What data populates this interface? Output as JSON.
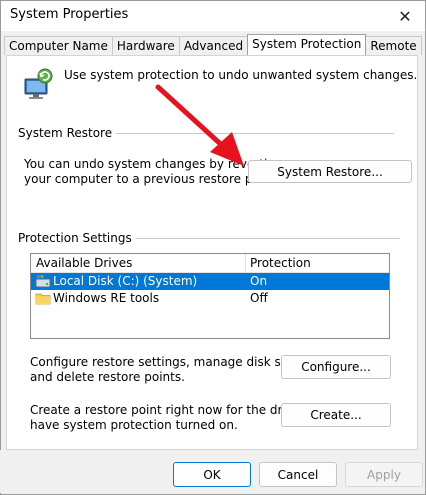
{
  "window": {
    "title": "System Properties"
  },
  "tabs": [
    {
      "label": "Computer Name"
    },
    {
      "label": "Hardware"
    },
    {
      "label": "Advanced"
    },
    {
      "label": "System Protection"
    },
    {
      "label": "Remote"
    }
  ],
  "active_tab": "System Protection",
  "intro": {
    "text": "Use system protection to undo unwanted system changes."
  },
  "system_restore": {
    "group_label": "System Restore",
    "description_line1": "You can undo system changes by reverting",
    "description_line2": "your computer to a previous restore point.",
    "button_label": "System Restore..."
  },
  "protection_settings": {
    "group_label": "Protection Settings",
    "columns": [
      "Available Drives",
      "Protection"
    ],
    "drives": [
      {
        "name": "Local Disk (C:) (System)",
        "protection": "On",
        "icon": "drive-icon",
        "selected": true
      },
      {
        "name": "Windows RE tools",
        "protection": "Off",
        "icon": "folder-icon",
        "selected": false
      }
    ],
    "configure_line1": "Configure restore settings, manage disk space,",
    "configure_line2": "and delete restore points.",
    "configure_button": "Configure...",
    "create_line1": "Create a restore point right now for the drives that",
    "create_line2": "have system protection turned on.",
    "create_button": "Create..."
  },
  "footer": {
    "ok": "OK",
    "cancel": "Cancel",
    "apply": "Apply"
  },
  "colors": {
    "selection": "#0078d7",
    "arrow": "#e8121f"
  }
}
